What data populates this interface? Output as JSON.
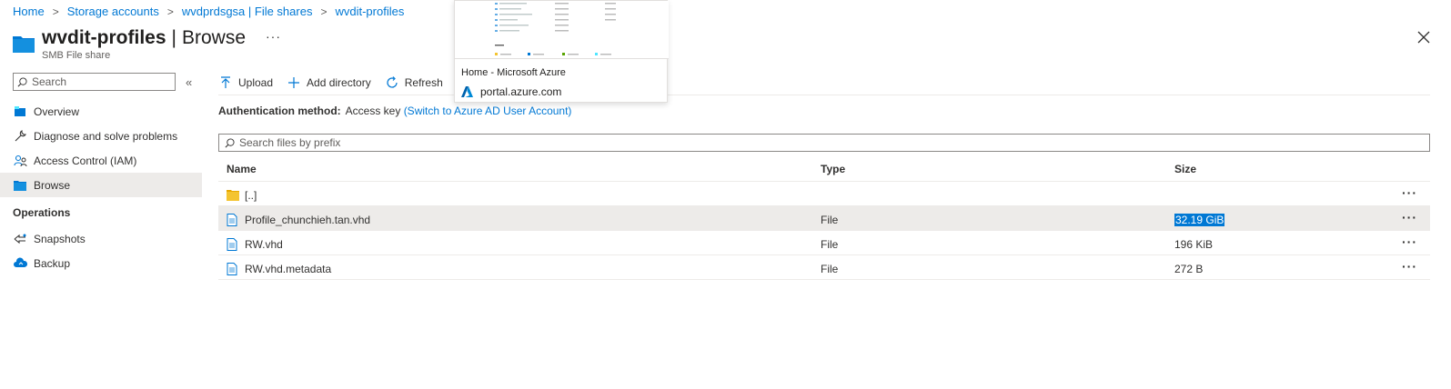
{
  "breadcrumb": {
    "items": [
      "Home",
      "Storage accounts",
      "wvdprdsgsa | File shares",
      "wvdit-profiles"
    ]
  },
  "header": {
    "title": "wvdit-profiles",
    "separator": "|",
    "subtitle_right": "Browse",
    "more": "···",
    "subtitle": "SMB File share"
  },
  "sidebar": {
    "search_placeholder": "Search",
    "collapse": "«",
    "items": [
      {
        "label": "Overview",
        "icon": "overview-icon"
      },
      {
        "label": "Diagnose and solve problems",
        "icon": "wrench-icon"
      },
      {
        "label": "Access Control (IAM)",
        "icon": "people-icon"
      },
      {
        "label": "Browse",
        "icon": "folder-icon"
      }
    ],
    "section": "Operations",
    "operations": [
      {
        "label": "Snapshots",
        "icon": "snapshot-icon"
      },
      {
        "label": "Backup",
        "icon": "backup-cloud-icon"
      }
    ]
  },
  "toolbar": {
    "upload": "Upload",
    "add_directory": "Add directory",
    "refresh": "Refresh"
  },
  "auth": {
    "label": "Authentication method:",
    "value": "Access key",
    "link": "(Switch to Azure AD User Account)"
  },
  "prefix_search": {
    "placeholder": "Search files by prefix"
  },
  "table": {
    "headers": {
      "name": "Name",
      "type": "Type",
      "size": "Size"
    },
    "rows": [
      {
        "name": "[..]",
        "type": "",
        "size": "",
        "kind": "folder"
      },
      {
        "name": "Profile_chunchieh.tan.vhd",
        "type": "File",
        "size": "32.19 GiB",
        "kind": "file"
      },
      {
        "name": "RW.vhd",
        "type": "File",
        "size": "196 KiB",
        "kind": "file"
      },
      {
        "name": "RW.vhd.metadata",
        "type": "File",
        "size": "272 B",
        "kind": "file"
      }
    ],
    "more": "···"
  },
  "popup": {
    "title": "Home - Microsoft Azure",
    "url": "portal.azure.com"
  },
  "colors": {
    "link": "#0078d4",
    "folder": "#f4c430",
    "selected_row": "#edebe9",
    "highlight": "#0078d4"
  }
}
